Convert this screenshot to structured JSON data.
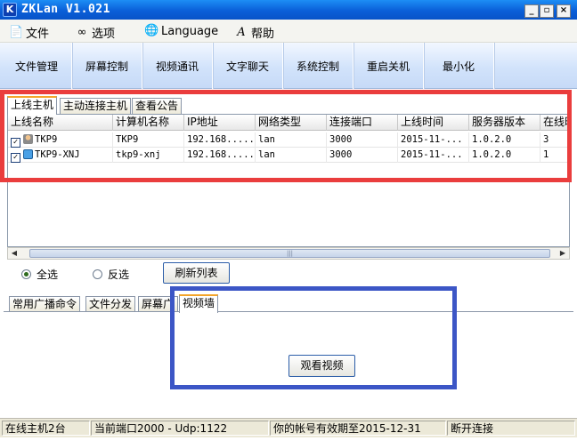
{
  "window": {
    "title": "ZKLan V1.021",
    "app_icon_letter": "K",
    "minimize_glyph": "_",
    "maximize_glyph": "▫",
    "close_glyph": "×"
  },
  "menu": {
    "items": [
      {
        "label": "文件",
        "icon": "document-icon"
      },
      {
        "label": "选项",
        "icon": "glasses-icon"
      },
      {
        "label": "Language",
        "icon": "translate-icon"
      },
      {
        "label": "帮助",
        "icon": "help-icon"
      }
    ]
  },
  "toolbar": {
    "buttons": [
      "文件管理",
      "屏幕控制",
      "视频通讯",
      "文字聊天",
      "系统控制",
      "重启关机",
      "最小化"
    ]
  },
  "upper_tabs": [
    "上线主机",
    "主动连接主机",
    "查看公告"
  ],
  "host_table": {
    "columns": [
      "上线名称",
      "计算机名称",
      "IP地址",
      "网络类型",
      "连接端口",
      "上线时间",
      "服务器版本",
      "在线时长"
    ],
    "rows": [
      {
        "checked": true,
        "name": "TKP9",
        "computer": "TKP9",
        "ip": "192.168.....",
        "net": "lan",
        "port": "3000",
        "time": "2015-11-...",
        "version": "1.0.2.0",
        "online": "3"
      },
      {
        "checked": true,
        "name": "TKP9-XNJ",
        "computer": "tkp9-xnj",
        "ip": "192.168.....",
        "net": "lan",
        "port": "3000",
        "time": "2015-11-...",
        "version": "1.0.2.0",
        "online": "1"
      }
    ]
  },
  "scrollbar": {
    "left_arrow": "◀",
    "right_arrow": "▶",
    "grip": "|||"
  },
  "selection": {
    "select_all": "全选",
    "invert": "反选",
    "refresh": "刷新列表",
    "selected": "select_all"
  },
  "lower_tabs": [
    "常用广播命令",
    "文件分发",
    "屏幕广",
    "视频墙"
  ],
  "video_wall": {
    "button": "观看视频"
  },
  "status": {
    "online": "在线主机2台",
    "port": "当前端口2000 - Udp:1122",
    "expiry": "你的帐号有效期至2015-12-31",
    "disconnect": "断开连接"
  },
  "colors": {
    "title_blue": "#0a5fd8",
    "highlight_red": "#ea3d3d",
    "highlight_blue": "#3c56c6",
    "tab_active_accent": "#f4a52a"
  }
}
